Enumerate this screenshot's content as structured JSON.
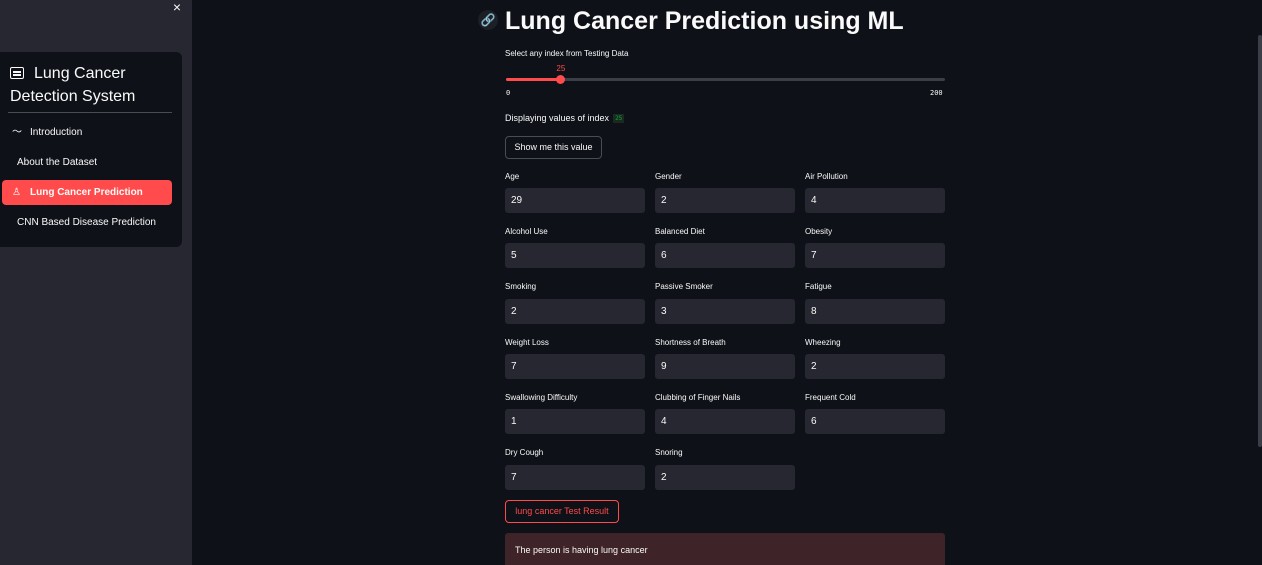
{
  "sidebar": {
    "close_icon": "×",
    "title": "Lung Cancer Detection System",
    "items": [
      {
        "label": "Introduction",
        "icon": "〜"
      },
      {
        "label": "About the Dataset"
      },
      {
        "label": "Lung Cancer Prediction",
        "icon": "♙"
      },
      {
        "label": "CNN Based Disease Prediction"
      }
    ]
  },
  "main": {
    "link_icon": "🔗",
    "title": "Lung Cancer Prediction using ML",
    "slider": {
      "label": "Select any index from Testing Data",
      "value": 25,
      "min": 0,
      "max": 200,
      "value_label": "25",
      "min_label": "0",
      "max_label": "200"
    },
    "display_text": "Displaying values of index",
    "display_index": "25",
    "show_button": "Show me this value",
    "fields": [
      {
        "label": "Age",
        "value": "29"
      },
      {
        "label": "Gender",
        "value": "2"
      },
      {
        "label": "Air Pollution",
        "value": "4"
      },
      {
        "label": "Alcohol Use",
        "value": "5"
      },
      {
        "label": "Balanced Diet",
        "value": "6"
      },
      {
        "label": "Obesity",
        "value": "7"
      },
      {
        "label": "Smoking",
        "value": "2"
      },
      {
        "label": "Passive Smoker",
        "value": "3"
      },
      {
        "label": "Fatigue",
        "value": "8"
      },
      {
        "label": "Weight Loss",
        "value": "7"
      },
      {
        "label": "Shortness of Breath",
        "value": "9"
      },
      {
        "label": "Wheezing",
        "value": "2"
      },
      {
        "label": "Swallowing Difficulty",
        "value": "1"
      },
      {
        "label": "Clubbing of Finger Nails",
        "value": "4"
      },
      {
        "label": "Frequent Cold",
        "value": "6"
      },
      {
        "label": "Dry Cough",
        "value": "7"
      },
      {
        "label": "Snoring",
        "value": "2"
      }
    ],
    "result_button": "lung cancer Test Result",
    "result_text": "The person is having lung cancer"
  },
  "colors": {
    "accent": "#ff4b4b",
    "background": "#0e1117",
    "sidebar": "#262730",
    "result_bg": "#3e2428"
  }
}
